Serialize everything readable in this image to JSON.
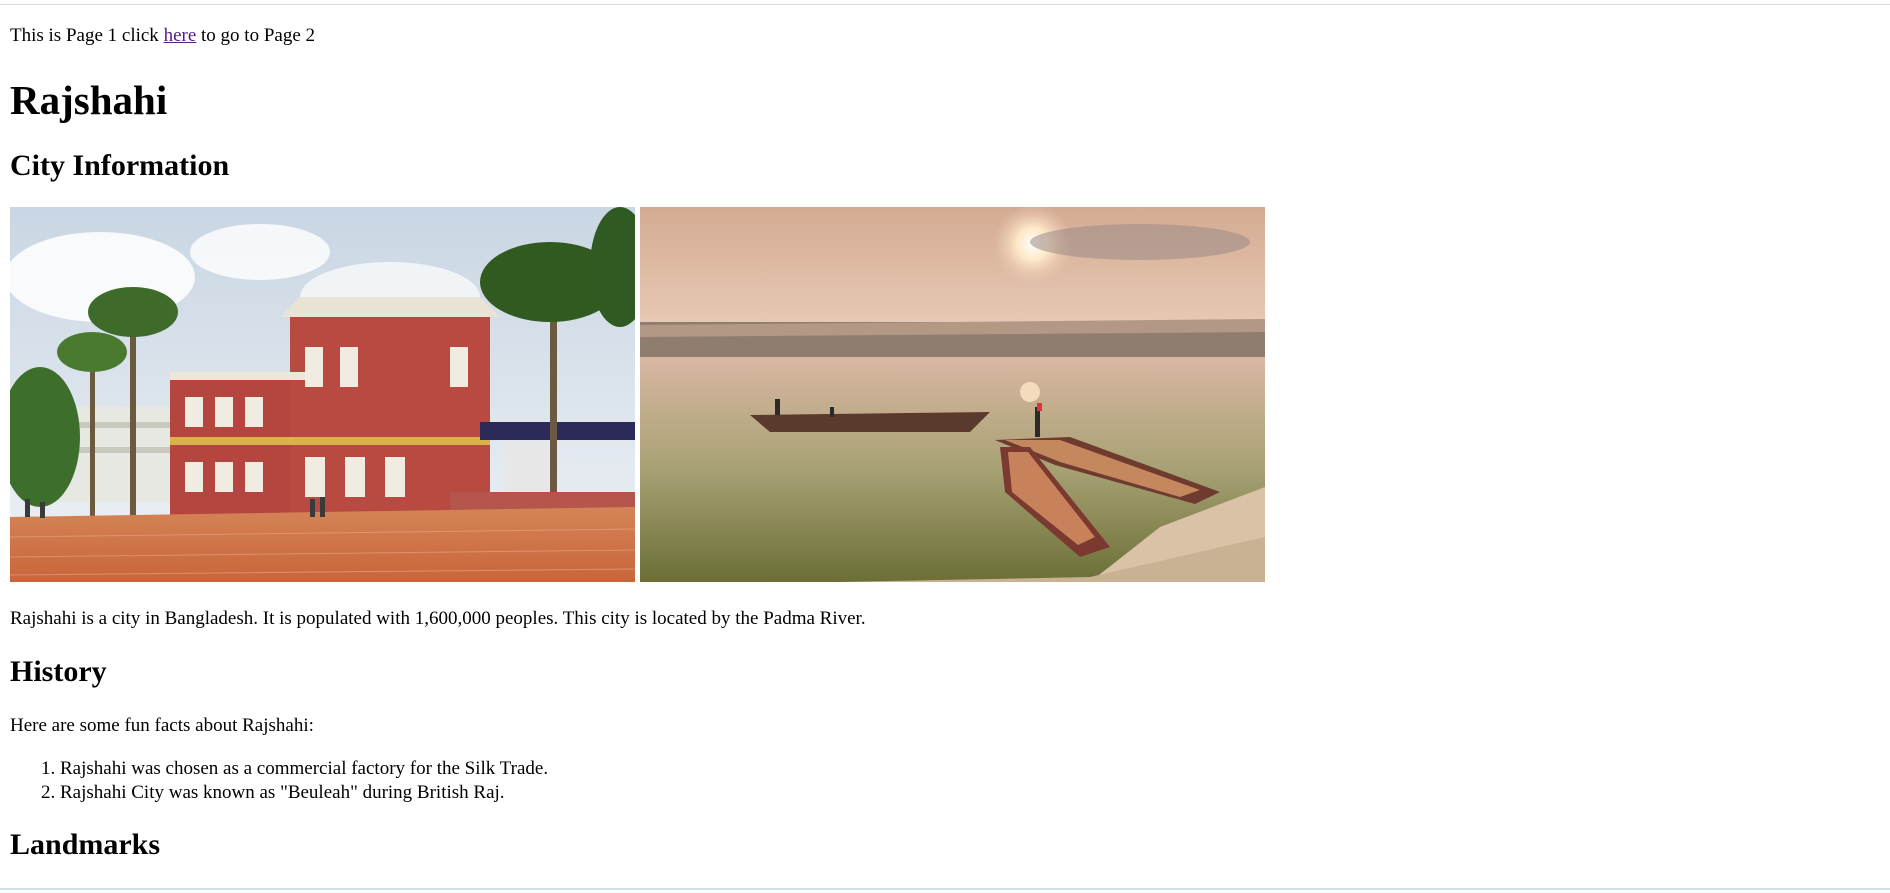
{
  "nav": {
    "prefix": "This is Page 1 click",
    "link_text": "here",
    "suffix": "to go to Page 2"
  },
  "page": {
    "title": "Rajshahi"
  },
  "city_info": {
    "heading": "City Information",
    "images": [
      {
        "subject": "red-colonial-building-with-palm-trees"
      },
      {
        "subject": "boats-on-padma-river-at-sunset"
      }
    ],
    "description": "Rajshahi is a city in Bangladesh. It is populated with 1,600,000 peoples. This city is located by the Padma River."
  },
  "history": {
    "heading": "History",
    "intro": "Here are some fun facts about Rajshahi:",
    "facts": [
      "Rajshahi was chosen as a commercial factory for the Silk Trade.",
      "Rajshahi City was known as \"Beuleah\" during British Raj."
    ]
  },
  "landmarks": {
    "heading": "Landmarks"
  },
  "colors": {
    "link": "#551A8B",
    "text": "#000000",
    "background": "#ffffff"
  }
}
